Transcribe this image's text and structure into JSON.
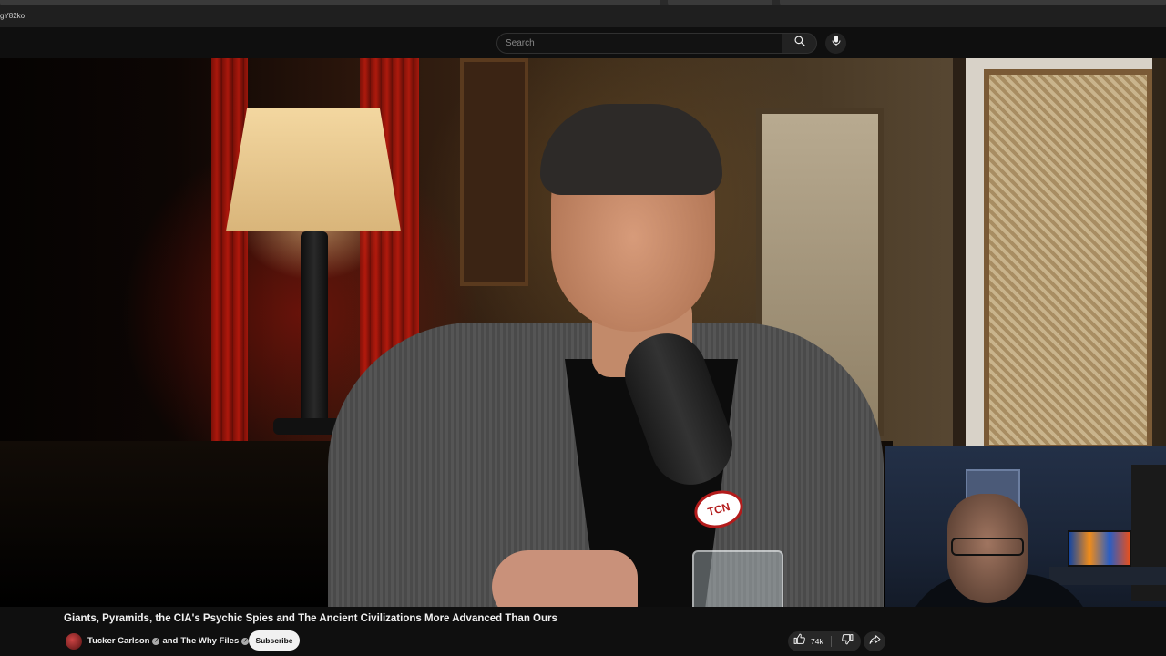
{
  "browser": {
    "url_fragment": "gY82ko"
  },
  "header": {
    "search": {
      "placeholder": "Search",
      "value": ""
    },
    "icons": {
      "search": "search-icon",
      "mic": "mic-icon"
    }
  },
  "video": {
    "mic_brand": "TCN"
  },
  "info": {
    "title": "Giants, Pyramids, the CIA's Psychic Spies and The Ancient Civilizations More Advanced Than Ours",
    "channel_primary": "Tucker Carlson",
    "channel_joiner": "and",
    "channel_secondary": "The Why Files",
    "subscribe_label": "Subscribe",
    "like_count": "74k"
  },
  "colors": {
    "background": "#0f0f0f",
    "button_bg": "#272727",
    "subscribe_bg": "#f1f1f1",
    "text": "#f1f1f1"
  }
}
